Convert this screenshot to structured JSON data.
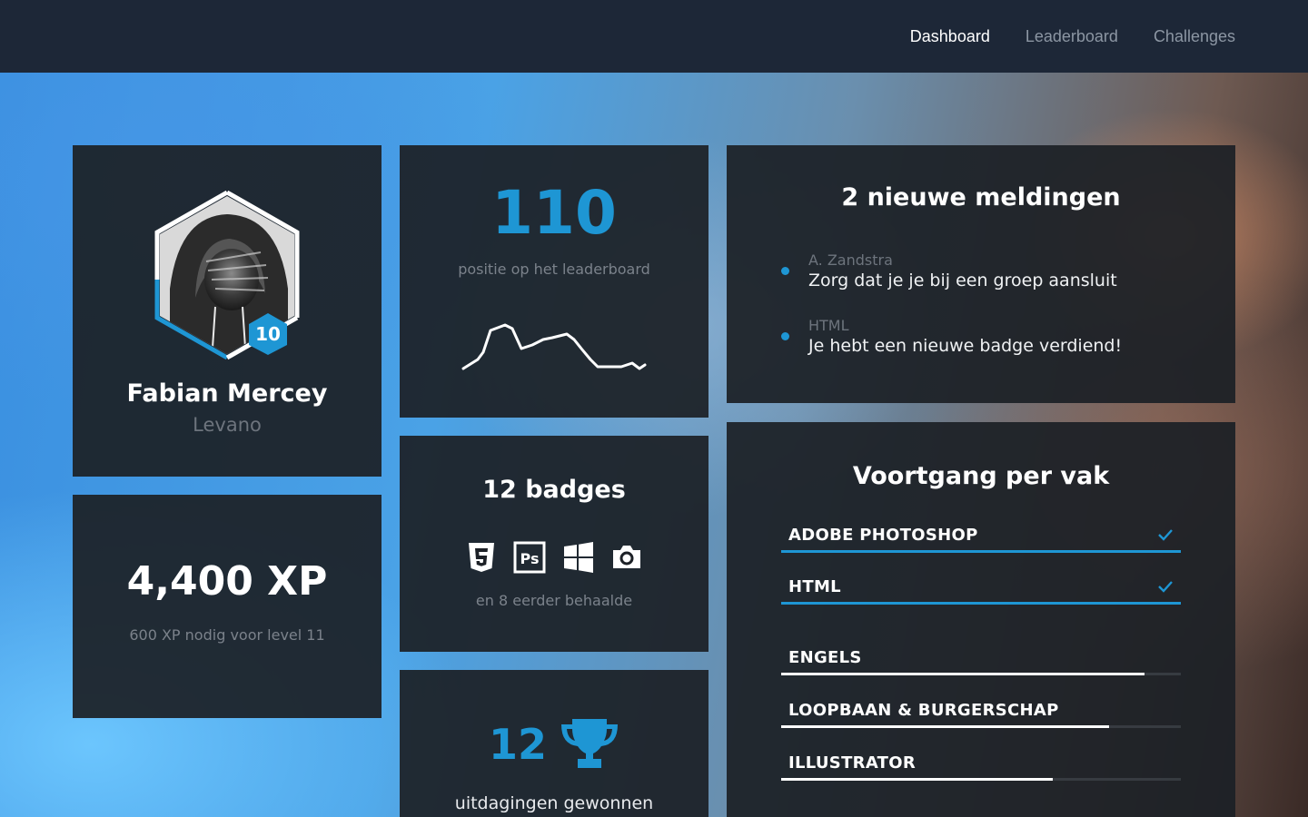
{
  "nav": {
    "items": [
      {
        "label": "Dashboard",
        "active": true
      },
      {
        "label": "Leaderboard",
        "active": false
      },
      {
        "label": "Challenges",
        "active": false
      }
    ]
  },
  "profile": {
    "name": "Fabian Mercey",
    "school": "Levano",
    "level": "10",
    "avatar_icon": "hooded-person-photo"
  },
  "xp": {
    "value": "4,400 XP",
    "note": "600 XP nodig voor level 11"
  },
  "rank": {
    "position": "110",
    "label": "positie op het leaderboard",
    "trend_icon": "sparkline-chart"
  },
  "badges": {
    "title": "12 badges",
    "icons": [
      "html5-icon",
      "photoshop-icon",
      "windows-icon",
      "camera-icon"
    ],
    "note": "en 8 eerder behaalde"
  },
  "challenges": {
    "count": "12",
    "label": "uitdagingen gewonnen",
    "icon": "trophy-icon"
  },
  "notifications": {
    "title": "2 nieuwe meldingen",
    "items": [
      {
        "from": "A. Zandstra",
        "message": "Zorg dat je je bij een groep aansluit"
      },
      {
        "from": "HTML",
        "message": "Je hebt een nieuwe badge verdiend!"
      }
    ]
  },
  "progress": {
    "title": "Voortgang per vak",
    "subjects": [
      {
        "label": "ADOBE PHOTOSHOP",
        "progress": 1.0,
        "completed": true
      },
      {
        "label": "HTML",
        "progress": 1.0,
        "completed": true
      },
      {
        "label": "ENGELS",
        "progress": 0.91,
        "completed": false
      },
      {
        "label": "LOOPBAAN & BURGERSCHAP",
        "progress": 0.82,
        "completed": false
      },
      {
        "label": "ILLUSTRATOR",
        "progress": 0.68,
        "completed": false
      }
    ]
  },
  "colors": {
    "accent": "#1e96d4",
    "complete_bar": "#1e96d4",
    "incomplete_bar": "#ffffff"
  }
}
